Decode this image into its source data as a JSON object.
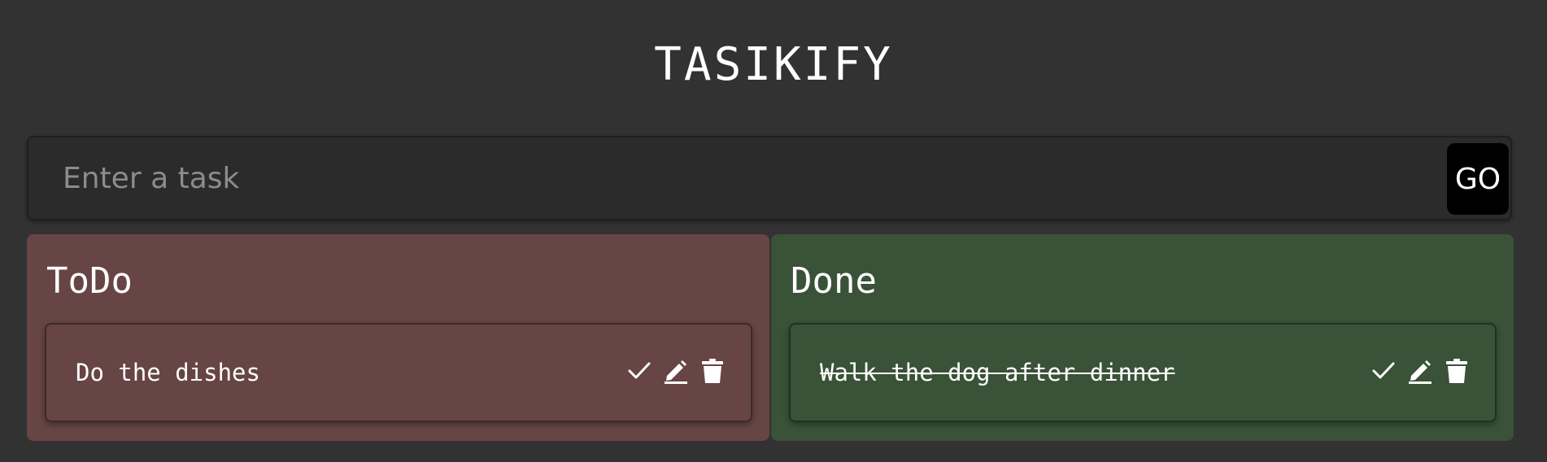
{
  "app": {
    "title": "TASIKIFY"
  },
  "form": {
    "input_placeholder": "Enter a task",
    "input_value": "",
    "submit_label": "GO"
  },
  "columns": {
    "todo": {
      "heading": "ToDo",
      "color": "#674544",
      "tasks": [
        {
          "text": "Do the dishes",
          "completed": false
        }
      ]
    },
    "done": {
      "heading": "Done",
      "color": "#3a5238",
      "tasks": [
        {
          "text": "Walk the dog after dinner",
          "completed": true
        }
      ]
    }
  },
  "icons": {
    "complete": "check-icon",
    "edit": "pencil-icon",
    "delete": "trash-icon"
  },
  "colors": {
    "background": "#323232",
    "input_background": "#2b2b2b",
    "button_background": "#000000"
  }
}
